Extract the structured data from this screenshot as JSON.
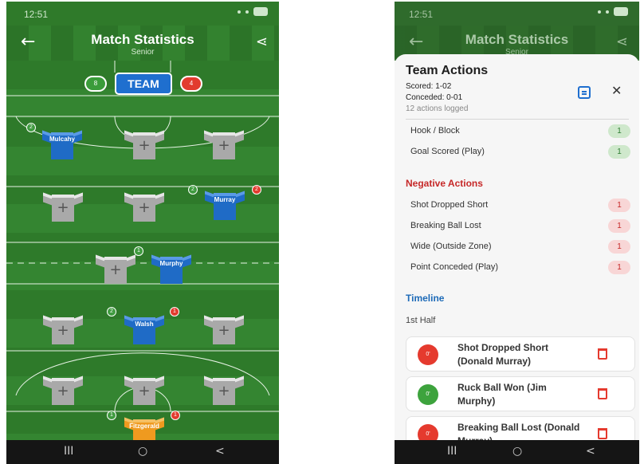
{
  "left_screen": {
    "status_time": "12:51",
    "title": "Match Statistics",
    "subtitle": "Senior",
    "team_button": "TEAM",
    "team_positive_count": "8",
    "team_negative_count": "4",
    "players": [
      {
        "name": "Mulcahy",
        "positive": "2"
      },
      {
        "name": "Murray",
        "positive": "2",
        "negative": "2"
      },
      {
        "name": "Murphy",
        "positive": "1"
      },
      {
        "name": "Walsh",
        "positive": "2",
        "negative": "1"
      },
      {
        "name": "Fitzgerald",
        "positive": "1",
        "negative": "1"
      }
    ],
    "empty_slot_symbol": "+",
    "nav": {
      "recent": "III",
      "home": "○",
      "back": "<"
    }
  },
  "right_screen": {
    "status_time": "12:51",
    "title_bg": "Match Statistics",
    "subtitle_bg": "Senior",
    "sheet": {
      "title": "Team Actions",
      "scored": "Scored: 1-02",
      "conceded": "Conceded: 0-01",
      "logged": "12 actions logged",
      "positive_actions": [
        {
          "label": "Hook / Block",
          "count": "1"
        },
        {
          "label": "Goal Scored (Play)",
          "count": "1"
        }
      ],
      "negative_heading": "Negative Actions",
      "negative_actions": [
        {
          "label": "Shot Dropped Short",
          "count": "1"
        },
        {
          "label": "Breaking Ball Lost",
          "count": "1"
        },
        {
          "label": "Wide (Outside Zone)",
          "count": "1"
        },
        {
          "label": "Point Conceded (Play)",
          "count": "1"
        }
      ],
      "timeline_heading": "Timeline",
      "half_label": "1st Half",
      "timeline": [
        {
          "minute": "0'",
          "text": "Shot Dropped Short (Donald Murray)",
          "kind": "negative"
        },
        {
          "minute": "0'",
          "text": "Ruck Ball Won (Jim Murphy)",
          "kind": "positive"
        },
        {
          "minute": "0'",
          "text": "Breaking Ball Lost (Donald Murray)",
          "kind": "negative"
        }
      ]
    },
    "nav": {
      "recent": "III",
      "home": "○",
      "back": "<"
    }
  },
  "colors": {
    "pitch_green": "#2f7a2a",
    "team_blue": "#1f6fcf",
    "positive_green": "#3da33d",
    "negative_red": "#e53a2e",
    "keeper_orange": "#ef9a1f"
  },
  "icons": [
    "back-arrow-icon",
    "share-icon",
    "plus-icon",
    "pdf-export-icon",
    "close-icon",
    "trash-icon"
  ]
}
